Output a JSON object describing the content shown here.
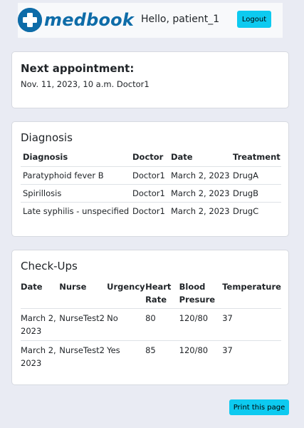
{
  "header": {
    "logo_text": "medbook",
    "greeting": "Hello, patient_1",
    "logout_label": "Logout"
  },
  "appointment": {
    "title": "Next appointment:",
    "details": "Nov. 11, 2023, 10 a.m. Doctor1"
  },
  "diagnosis": {
    "title": "Diagnosis",
    "columns": [
      "Diagnosis",
      "Doctor",
      "Date",
      "Treatment"
    ],
    "rows": [
      [
        "Paratyphoid fever B",
        "Doctor1",
        "March 2, 2023",
        "DrugA"
      ],
      [
        "Spirillosis",
        "Doctor1",
        "March 2, 2023",
        "DrugB"
      ],
      [
        "Late syphilis - unspecified",
        "Doctor1",
        "March 2, 2023",
        "DrugC"
      ]
    ]
  },
  "checkups": {
    "title": "Check-Ups",
    "columns": [
      "Date",
      "Nurse",
      "Urgency",
      "Heart Rate",
      "Blood Presure",
      "Temperature"
    ],
    "rows": [
      [
        "March 2, 2023",
        "NurseTest2",
        "No",
        "80",
        "120/80",
        "37"
      ],
      [
        "March 2, 2023",
        "NurseTest2",
        "Yes",
        "85",
        "120/80",
        "37"
      ]
    ]
  },
  "print_label": "Print this page",
  "colors": {
    "brand": "#0e6ca8",
    "button": "#0dcaf0",
    "background": "#e9ebf3"
  },
  "icons": {
    "logo": "medical-cross-icon"
  }
}
